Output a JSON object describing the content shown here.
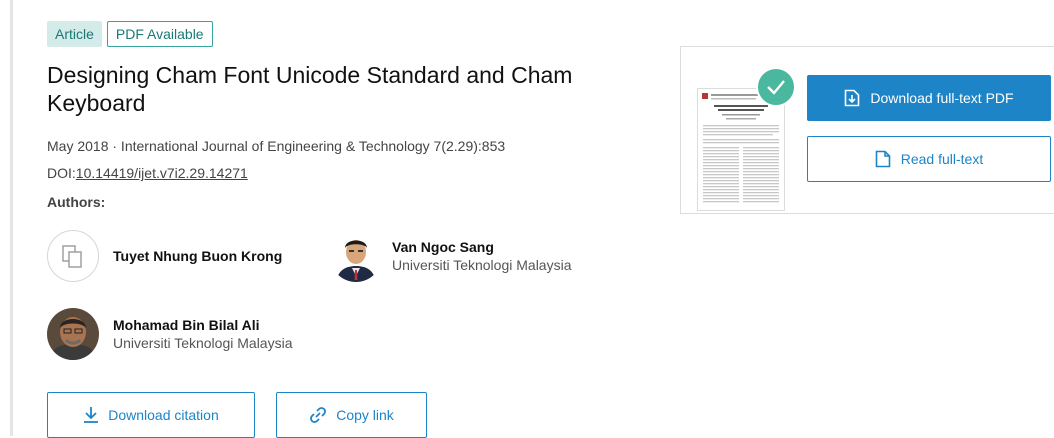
{
  "badges": {
    "article": "Article",
    "pdf": "PDF Available"
  },
  "publication": {
    "title": "Designing Cham Font Unicode Standard and Cham Keyboard",
    "meta": "May 2018 · International Journal of Engineering & Technology 7(2.29):853",
    "doi_prefix": "DOI:",
    "doi": "10.14419/ijet.v7i2.29.14271",
    "authors_label": "Authors:"
  },
  "authors": [
    {
      "name": "Tuyet Nhung Buon Krong",
      "affiliation": ""
    },
    {
      "name": "Van Ngoc Sang",
      "affiliation": "Universiti Teknologi Malaysia"
    },
    {
      "name": "Mohamad Bin Bilal Ali",
      "affiliation": "Universiti Teknologi Malaysia"
    }
  ],
  "actions": {
    "download_citation": "Download citation",
    "copy_link": "Copy link"
  },
  "fulltext_card": {
    "download_pdf": "Download full-text PDF",
    "read_fulltext": "Read full-text"
  },
  "colors": {
    "accent": "#1d84c7",
    "badge_text": "#1a7a73",
    "check": "#4ab79f"
  }
}
